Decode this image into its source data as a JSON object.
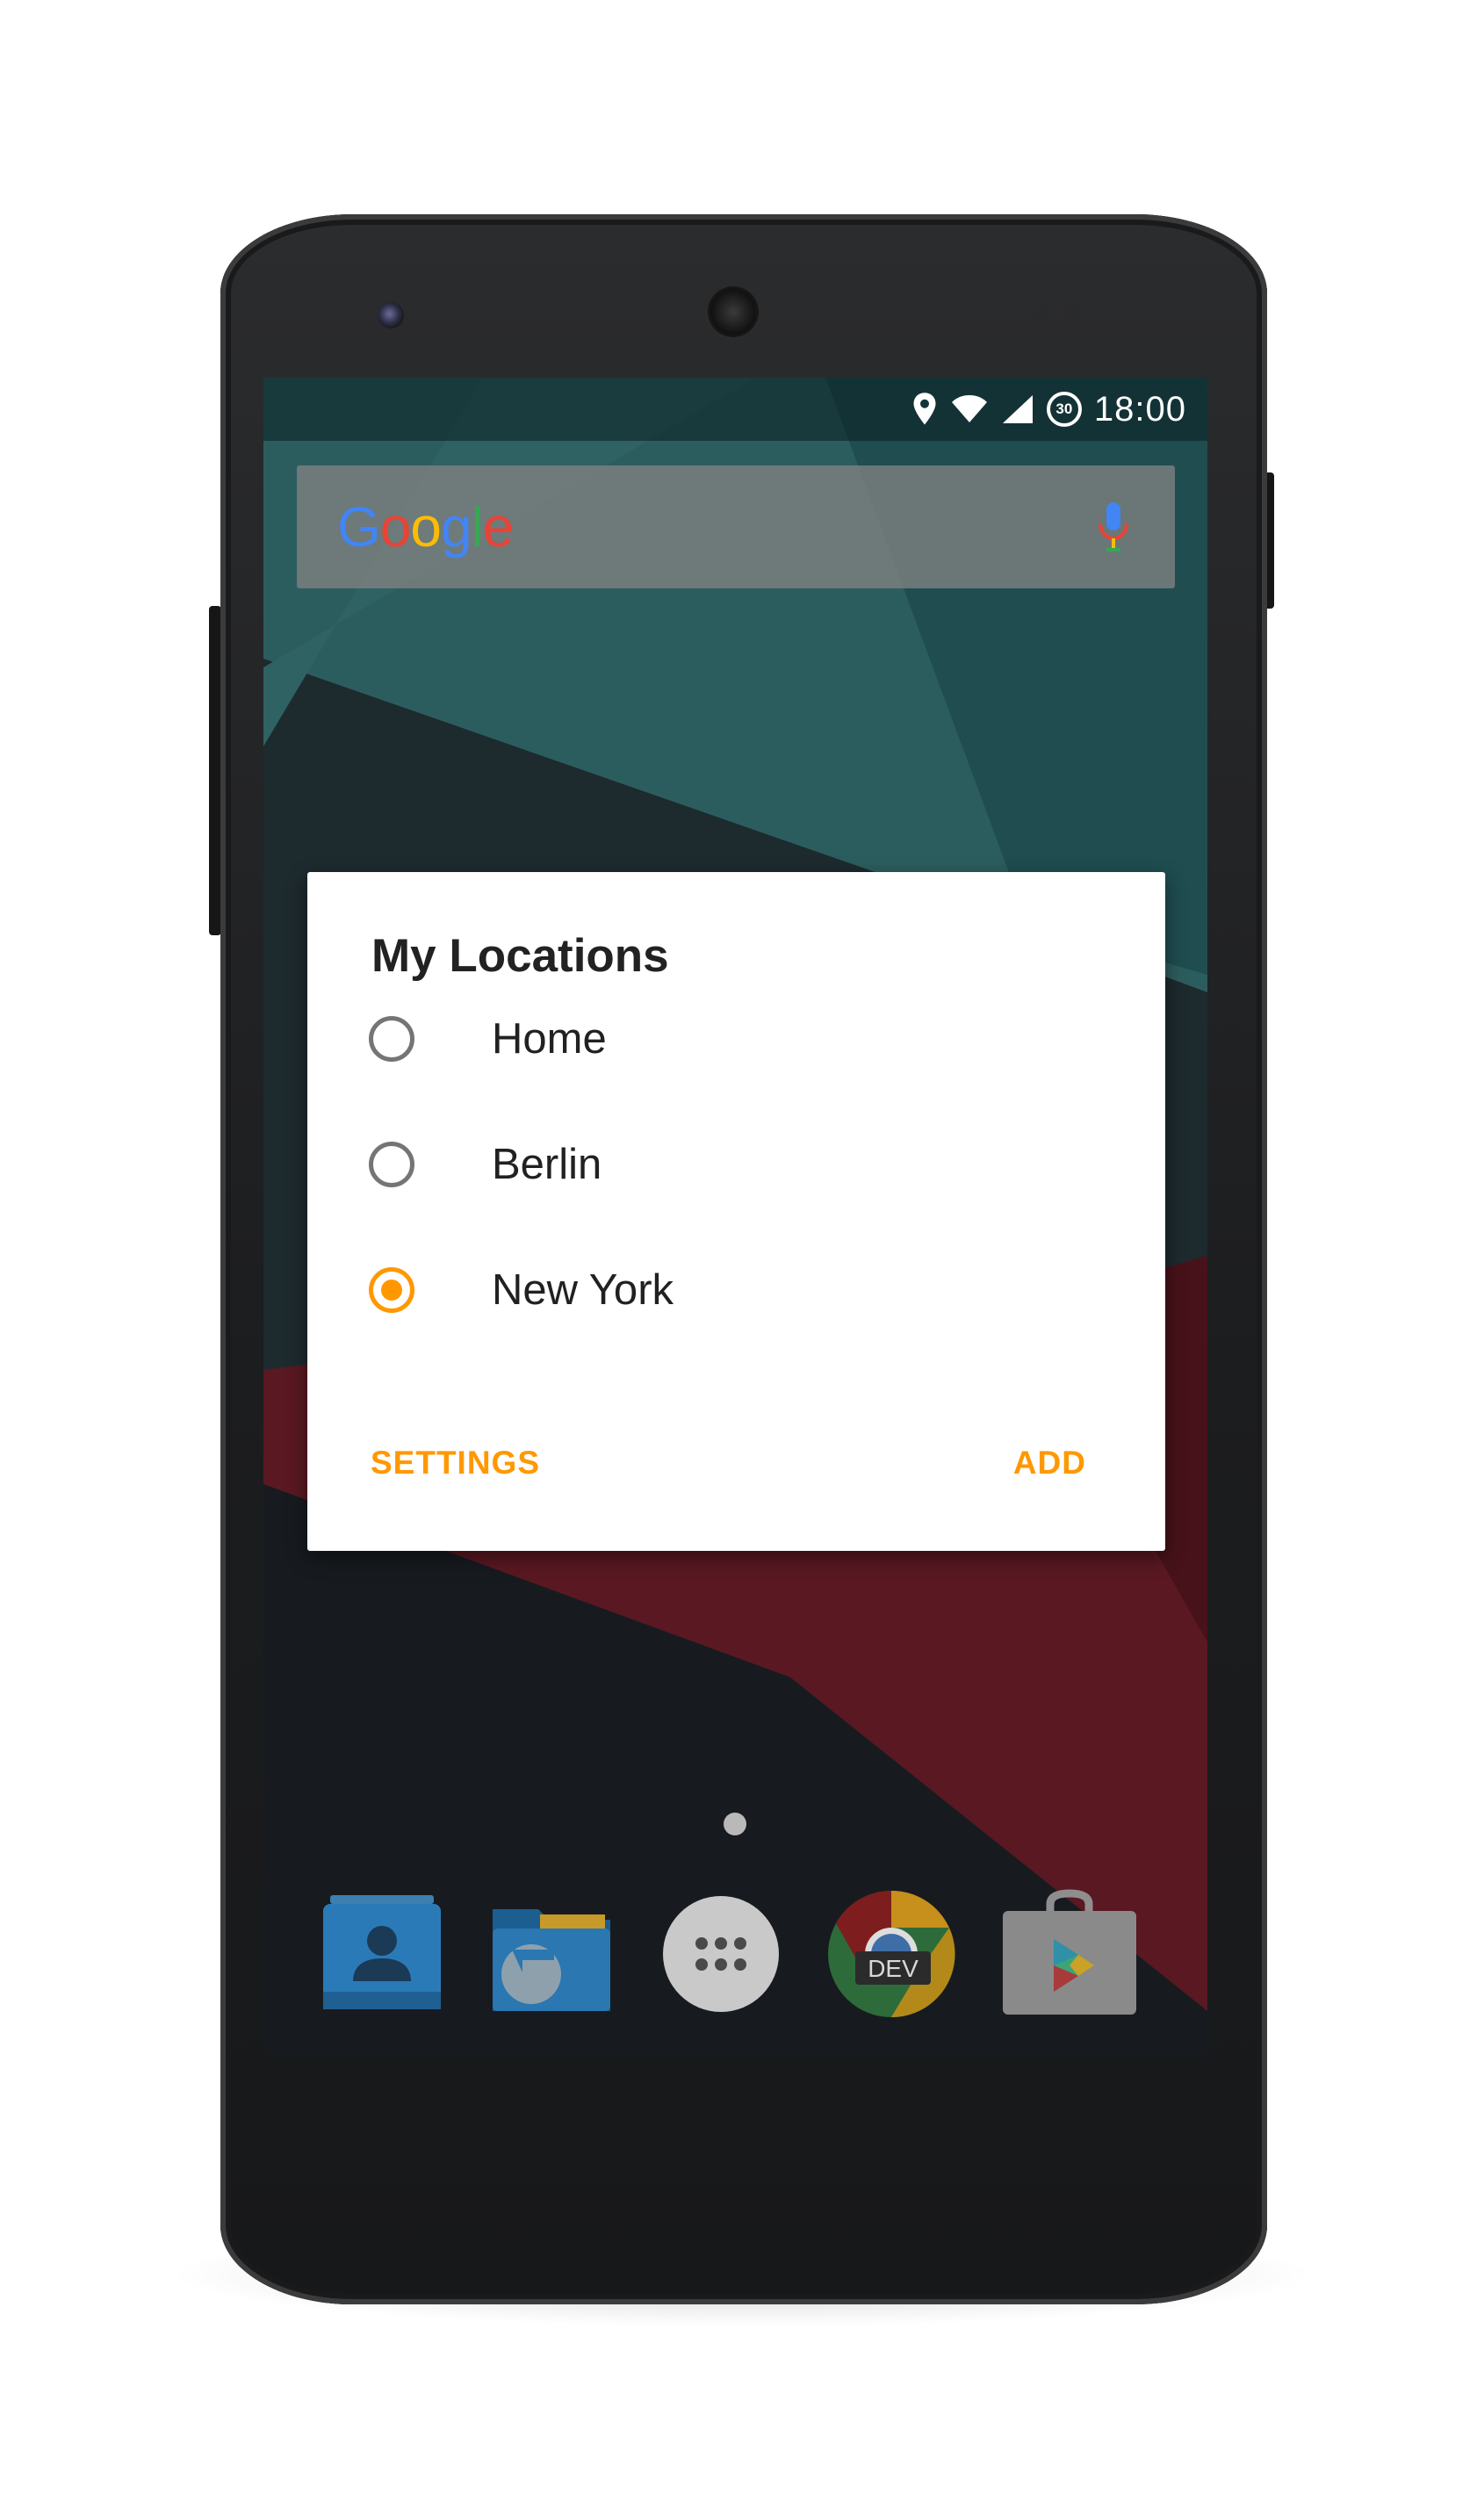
{
  "status_bar": {
    "time": "18:00",
    "timer_badge": "30",
    "icons": [
      "location-icon",
      "wifi-icon",
      "signal-icon",
      "timer-icon"
    ]
  },
  "search": {
    "logo_text": "Google",
    "logo_letters": [
      "G",
      "o",
      "o",
      "g",
      "l",
      "e"
    ],
    "logo_colors": [
      "#4285f4",
      "#ea4335",
      "#fbbc05",
      "#4285f4",
      "#34a853",
      "#ea4335"
    ],
    "mic_icon": "mic-icon"
  },
  "dialog": {
    "title": "My Locations",
    "options": [
      {
        "label": "Home",
        "selected": false
      },
      {
        "label": "Berlin",
        "selected": false
      },
      {
        "label": "New York",
        "selected": true
      }
    ],
    "buttons": {
      "settings": "SETTINGS",
      "add": "ADD"
    }
  },
  "dock": {
    "apps": [
      {
        "name": "contacts-app-icon"
      },
      {
        "name": "file-manager-app-icon"
      },
      {
        "name": "app-drawer-icon"
      },
      {
        "name": "chrome-dev-app-icon",
        "badge": "DEV"
      },
      {
        "name": "play-store-app-icon"
      }
    ]
  },
  "colors": {
    "accent": "#ff9800",
    "wallpaper_teal": "#2a5e5e",
    "wallpaper_red": "#5a1822"
  }
}
